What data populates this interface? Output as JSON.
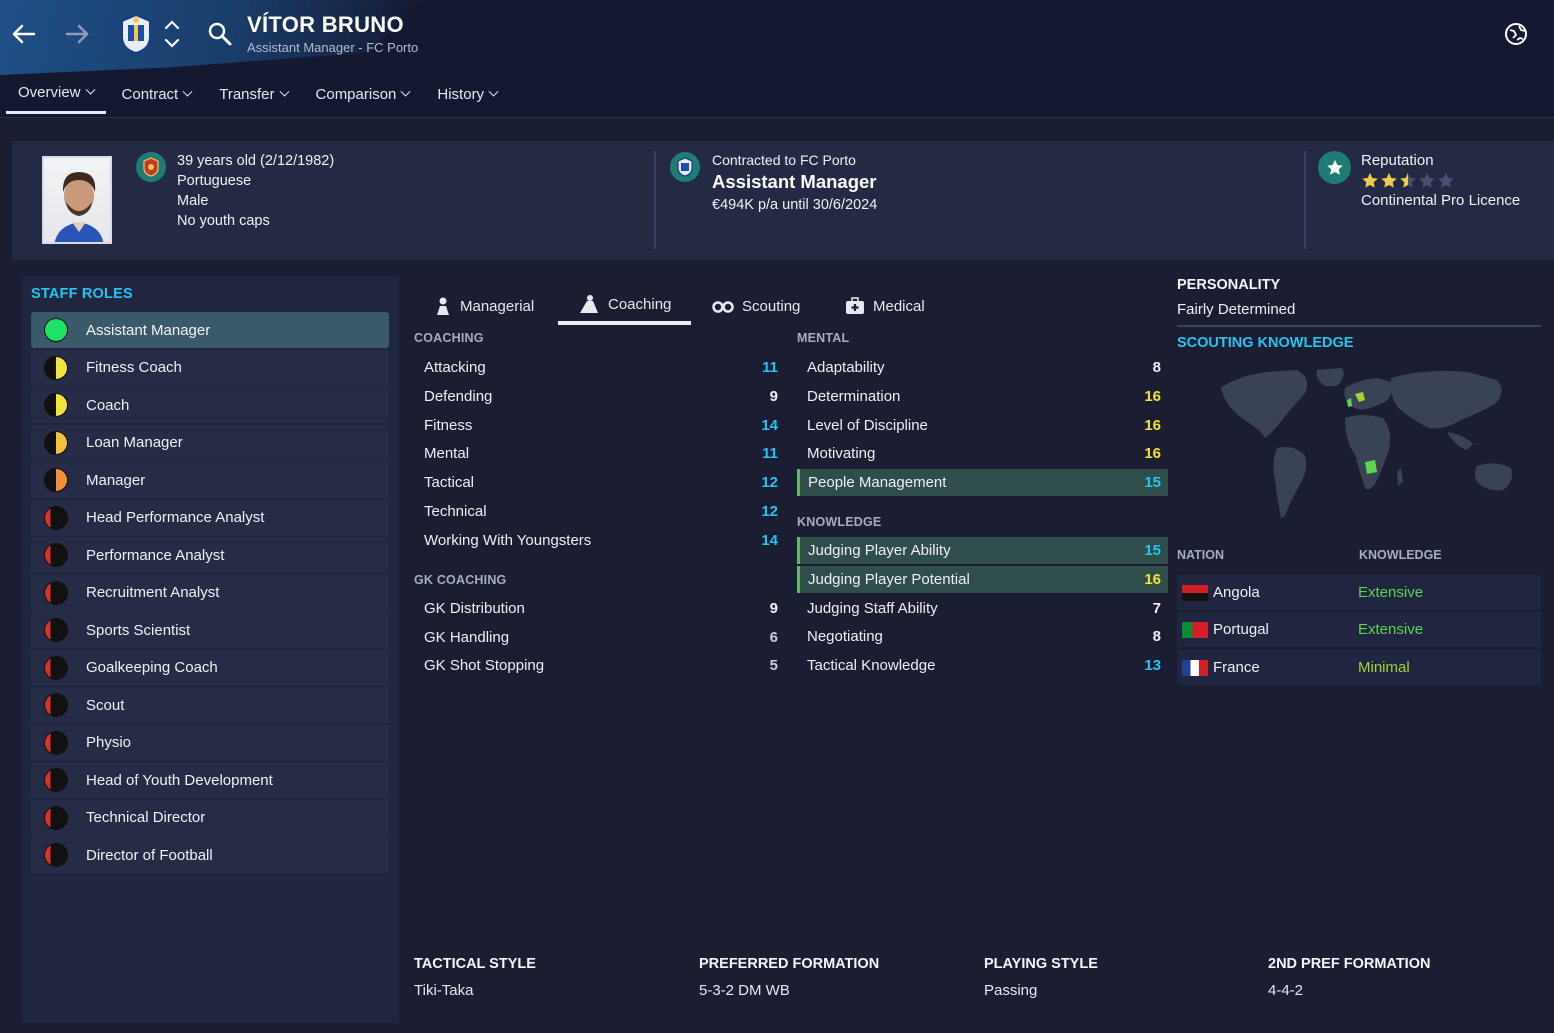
{
  "header": {
    "name": "VÍTOR BRUNO",
    "subtitle": "Assistant Manager - FC Porto",
    "tabs": [
      "Overview",
      "Contract",
      "Transfer",
      "Comparison",
      "History"
    ]
  },
  "profile": {
    "age": "39 years old (2/12/1982)",
    "nationality": "Portuguese",
    "gender": "Male",
    "caps": "No youth caps"
  },
  "contract": {
    "club_line": "Contracted to FC Porto",
    "role": "Assistant Manager",
    "wage": "€494K p/a until 30/6/2024"
  },
  "reputation": {
    "label": "Reputation",
    "stars": 2.5,
    "max_stars": 5,
    "licence": "Continental Pro Licence"
  },
  "staff_roles": {
    "title": "STAFF ROLES",
    "items": [
      {
        "label": "Assistant Manager",
        "color": "#1ee36a",
        "selected": true
      },
      {
        "label": "Fitness Coach",
        "color": "#f2e33a"
      },
      {
        "label": "Coach",
        "color": "#f2e33a"
      },
      {
        "label": "Loan Manager",
        "color": "#f4c23a"
      },
      {
        "label": "Manager",
        "color": "#f2903a"
      },
      {
        "label": "Head Performance Analyst",
        "color": "#d9312b"
      },
      {
        "label": "Performance Analyst",
        "color": "#d9312b"
      },
      {
        "label": "Recruitment Analyst",
        "color": "#d9312b"
      },
      {
        "label": "Sports Scientist",
        "color": "#d9312b"
      },
      {
        "label": "Goalkeeping Coach",
        "color": "#d9312b"
      },
      {
        "label": "Scout",
        "color": "#d9312b"
      },
      {
        "label": "Physio",
        "color": "#d9312b"
      },
      {
        "label": "Head of Youth Development",
        "color": "#d9312b"
      },
      {
        "label": "Technical Director",
        "color": "#d9312b"
      },
      {
        "label": "Director of Football",
        "color": "#d9312b"
      }
    ]
  },
  "attr_tabs": [
    "Managerial",
    "Coaching",
    "Scouting",
    "Medical"
  ],
  "coaching": {
    "title": "COACHING",
    "items": [
      {
        "label": "Attacking",
        "value": "11",
        "color": "#22c6f0"
      },
      {
        "label": "Defending",
        "value": "9",
        "color": "#eef0f6"
      },
      {
        "label": "Fitness",
        "value": "14",
        "color": "#22c6f0"
      },
      {
        "label": "Mental",
        "value": "11",
        "color": "#22c6f0"
      },
      {
        "label": "Tactical",
        "value": "12",
        "color": "#22c6f0"
      },
      {
        "label": "Technical",
        "value": "12",
        "color": "#22c6f0"
      },
      {
        "label": "Working With Youngsters",
        "value": "14",
        "color": "#22c6f0"
      }
    ]
  },
  "gk_coaching": {
    "title": "GK COACHING",
    "items": [
      {
        "label": "GK Distribution",
        "value": "9",
        "color": "#eef0f6"
      },
      {
        "label": "GK Handling",
        "value": "6",
        "color": "#c9ccd8"
      },
      {
        "label": "GK Shot Stopping",
        "value": "5",
        "color": "#c9ccd8"
      }
    ]
  },
  "mental": {
    "title": "MENTAL",
    "items": [
      {
        "label": "Adaptability",
        "value": "8",
        "color": "#eef0f6",
        "hl": false
      },
      {
        "label": "Determination",
        "value": "16",
        "color": "#f2e33a",
        "hl": false
      },
      {
        "label": "Level of Discipline",
        "value": "16",
        "color": "#f2e33a",
        "hl": false
      },
      {
        "label": "Motivating",
        "value": "16",
        "color": "#f2e33a",
        "hl": false
      },
      {
        "label": "People Management",
        "value": "15",
        "color": "#22c6f0",
        "hl": true
      }
    ]
  },
  "knowledge": {
    "title": "KNOWLEDGE",
    "items": [
      {
        "label": "Judging Player Ability",
        "value": "15",
        "color": "#22c6f0",
        "hl": true
      },
      {
        "label": "Judging Player Potential",
        "value": "16",
        "color": "#f2e33a",
        "hl": true
      },
      {
        "label": "Judging Staff Ability",
        "value": "7",
        "color": "#eef0f6",
        "hl": false
      },
      {
        "label": "Negotiating",
        "value": "8",
        "color": "#eef0f6",
        "hl": false
      },
      {
        "label": "Tactical Knowledge",
        "value": "13",
        "color": "#22c6f0",
        "hl": false
      }
    ]
  },
  "personality": {
    "title": "PERSONALITY",
    "value": "Fairly Determined"
  },
  "scouting_knowledge": {
    "title": "SCOUTING KNOWLEDGE",
    "col_nation": "NATION",
    "col_knowledge": "KNOWLEDGE",
    "rows": [
      {
        "nation": "Angola",
        "level": "Extensive",
        "color": "#5bd44e"
      },
      {
        "nation": "Portugal",
        "level": "Extensive",
        "color": "#5bd44e"
      },
      {
        "nation": "France",
        "level": "Minimal",
        "color": "#a3d236"
      }
    ]
  },
  "bottom": {
    "tactical_style": {
      "label": "TACTICAL STYLE",
      "value": "Tiki-Taka"
    },
    "preferred_formation": {
      "label": "PREFERRED FORMATION",
      "value": "5-3-2 DM WB"
    },
    "playing_style": {
      "label": "PLAYING STYLE",
      "value": "Passing"
    },
    "second_formation": {
      "label": "2ND PREF FORMATION",
      "value": "4-4-2"
    }
  }
}
